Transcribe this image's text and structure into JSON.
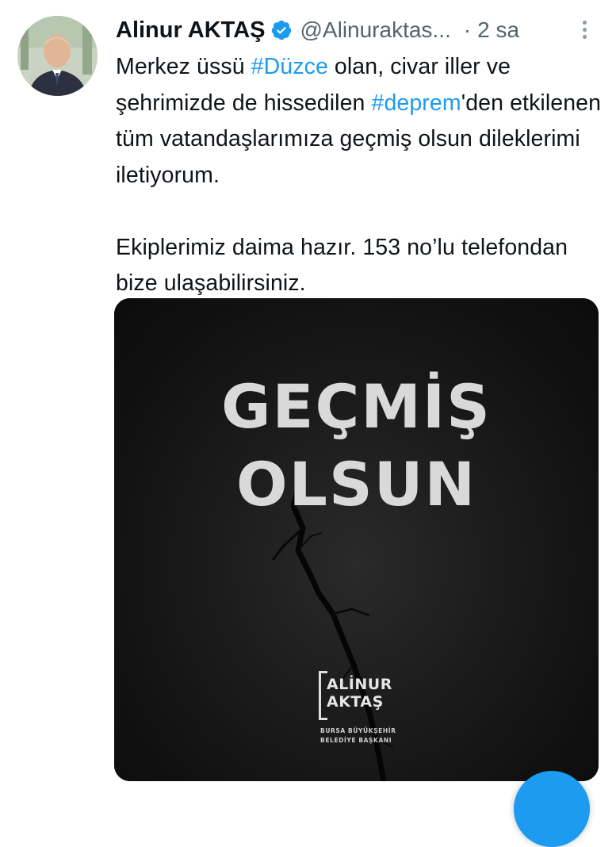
{
  "tweet": {
    "author_name": "Alinur AKTAŞ",
    "handle": "@Alinuraktas...",
    "separator": "·",
    "time": "2 sa",
    "verified_icon": "verified-badge-icon",
    "body": {
      "p1_a": "Merkez üssü ",
      "p1_hashtag1": "#Düzce",
      "p1_b": " olan, civar iller ve şehrimizde de hissedilen ",
      "p1_hashtag2": "#deprem",
      "p1_c": "'den etkilenen tüm vatandaşlarımıza geçmiş olsun dileklerimi iletiyorum.",
      "p2": "Ekiplerimiz daima hazır. 153 no’lu telefondan bize ulaşabilirsiniz."
    },
    "media": {
      "headline_line1": "GEÇMİŞ",
      "headline_line2": "OLSUN",
      "logo_line1": "ALİNUR",
      "logo_line2": "AKTAŞ",
      "logo_sub1": "BURSA BÜYÜKŞEHİR",
      "logo_sub2": "BELEDİYE BAŞKANI"
    }
  },
  "colors": {
    "hashtag": "#1d9bf0",
    "secondary_text": "#536471",
    "fab": "#1d9bf0"
  },
  "icons": {
    "more": "more-options-icon",
    "fab": "compose-tweet-icon"
  }
}
